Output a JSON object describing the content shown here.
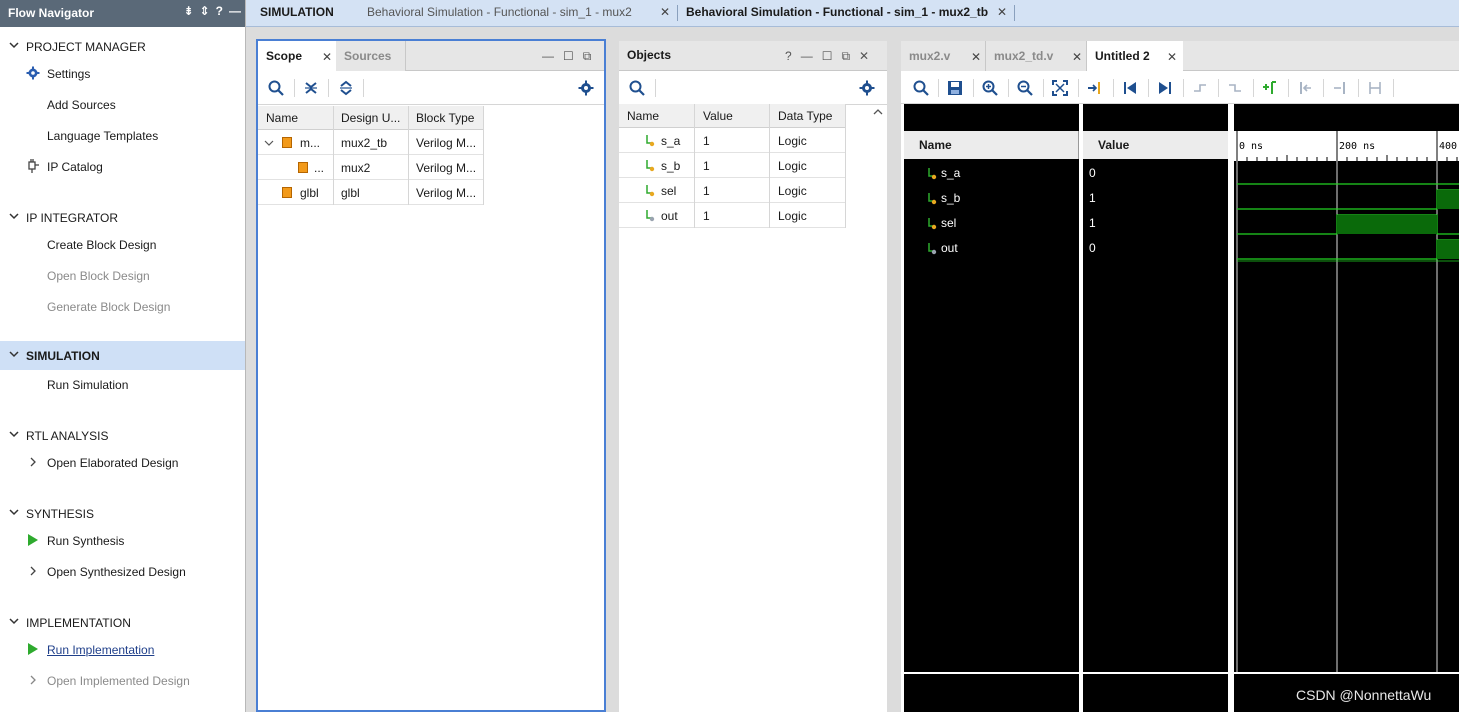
{
  "flow_navigator": {
    "title": "Flow Navigator",
    "sections": [
      {
        "label": "PROJECT MANAGER",
        "items": [
          "Settings",
          "Add Sources",
          "Language Templates",
          "IP Catalog"
        ]
      },
      {
        "label": "IP INTEGRATOR",
        "items": [
          "Create Block Design",
          "Open Block Design",
          "Generate Block Design"
        ]
      },
      {
        "label": "SIMULATION",
        "items": [
          "Run Simulation"
        ]
      },
      {
        "label": "RTL ANALYSIS",
        "items": [
          "Open Elaborated Design"
        ]
      },
      {
        "label": "SYNTHESIS",
        "items": [
          "Run Synthesis",
          "Open Synthesized Design"
        ]
      },
      {
        "label": "IMPLEMENTATION",
        "items": [
          "Run Implementation",
          "Open Implemented Design"
        ]
      }
    ]
  },
  "top_tabs": {
    "mode": "SIMULATION",
    "tab1": "Behavioral Simulation - Functional - sim_1 - mux2",
    "tab2": "Behavioral Simulation - Functional - sim_1 - mux2_tb"
  },
  "scope_panel": {
    "tab_scope": "Scope",
    "tab_sources": "Sources",
    "columns": [
      "Name",
      "Design U...",
      "Block Type"
    ],
    "rows": [
      {
        "name": "m...",
        "design_unit": "mux2_tb",
        "block_type": "Verilog M..."
      },
      {
        "name": "...",
        "design_unit": "mux2",
        "block_type": "Verilog M..."
      },
      {
        "name": "glbl",
        "design_unit": "glbl",
        "block_type": "Verilog M..."
      }
    ]
  },
  "objects_panel": {
    "title": "Objects",
    "columns": [
      "Name",
      "Value",
      "Data Type"
    ],
    "rows": [
      {
        "name": "s_a",
        "value": "1",
        "type": "Logic"
      },
      {
        "name": "s_b",
        "value": "1",
        "type": "Logic"
      },
      {
        "name": "sel",
        "value": "1",
        "type": "Logic"
      },
      {
        "name": "out",
        "value": "1",
        "type": "Logic"
      }
    ]
  },
  "wave_panel": {
    "tabs": [
      "mux2.v",
      "mux2_td.v",
      "Untitled 2"
    ],
    "col_name": "Name",
    "col_value": "Value",
    "signals": [
      {
        "name": "s_a",
        "value": "0"
      },
      {
        "name": "s_b",
        "value": "1"
      },
      {
        "name": "sel",
        "value": "1"
      },
      {
        "name": "out",
        "value": "0"
      }
    ],
    "time_labels": [
      "0 ns",
      "200 ns",
      "400"
    ]
  },
  "watermark": "CSDN @NonnettaWu",
  "colors": {
    "header_bg": "#5a6978",
    "active_section": "#cfe0f6",
    "run_green": "#2eaa2e",
    "wave_green": "#22d322",
    "wave_fill": "#0a6a0a"
  }
}
